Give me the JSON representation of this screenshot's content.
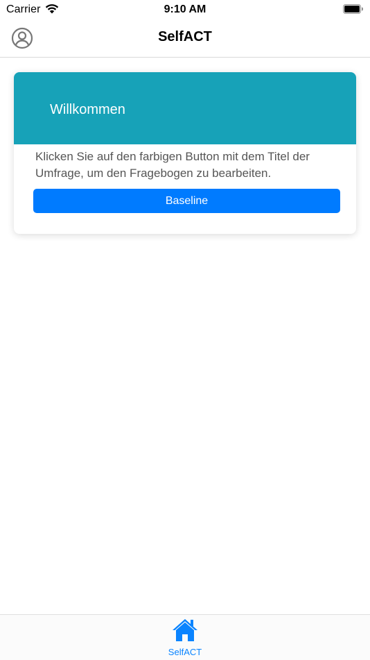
{
  "status_bar": {
    "carrier": "Carrier",
    "time": "9:10 AM"
  },
  "nav": {
    "title": "SelfACT",
    "avatar_icon": "person-circle-icon"
  },
  "card": {
    "title": "Willkommen",
    "text": "Klicken Sie auf den farbigen Button mit dem Titel der Umfrage, um den Fragebogen zu bearbeiten.",
    "button_label": "Baseline",
    "header_color": "#17a2b8",
    "button_color": "#007bff"
  },
  "tabbar": {
    "items": [
      {
        "label": "SelfACT",
        "icon": "home-icon",
        "active": true
      }
    ],
    "accent": "#0a84ff"
  }
}
